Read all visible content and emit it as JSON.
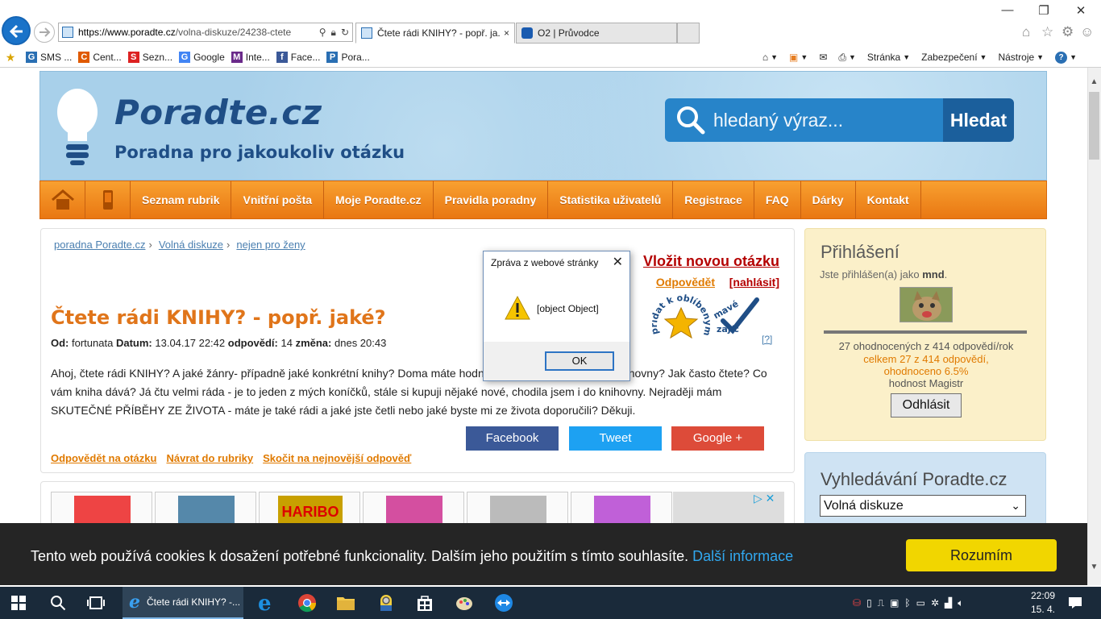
{
  "browser": {
    "url_domain": "https://www.poradte.cz",
    "url_path": "/volna-diskuze/24238-ctete",
    "tabs": [
      {
        "label": "Čtete rádi KNIHY? - popř. ja...",
        "close": "×"
      },
      {
        "label": "O2 | Průvodce"
      }
    ],
    "favorites": [
      {
        "label": "SMS ...",
        "icon": "G",
        "color": "#2a6fb3"
      },
      {
        "label": "Cent...",
        "icon": "C",
        "color": "#e05a00"
      },
      {
        "label": "Sezn...",
        "icon": "S",
        "color": "#d22"
      },
      {
        "label": "Google",
        "icon": "G",
        "color": "#4285f4"
      },
      {
        "label": "Inte...",
        "icon": "M",
        "color": "#6a2a8a"
      },
      {
        "label": "Face...",
        "icon": "f",
        "color": "#3b5998"
      },
      {
        "label": "Pora...",
        "icon": "P",
        "color": "#2a6fb3"
      }
    ],
    "commands": [
      {
        "label": "Stránka"
      },
      {
        "label": "Zabezpečení"
      },
      {
        "label": "Nástroje"
      }
    ]
  },
  "site": {
    "logo_title": "Poradte.cz",
    "logo_subtitle": "Poradna pro jakoukoliv otázku",
    "search_placeholder": "hledaný výraz...",
    "search_button": "Hledat",
    "nav": [
      "Seznam rubrik",
      "Vnitřní pošta",
      "Moje Poradte.cz",
      "Pravidla poradny",
      "Statistika uživatelů",
      "Registrace",
      "FAQ",
      "Dárky",
      "Kontakt"
    ]
  },
  "question": {
    "breadcrumb": [
      "poradna Poradte.cz",
      "Volná diskuze",
      "nejen pro ženy"
    ],
    "new_question": "Vložit novou otázku",
    "answer": "Odpovědět",
    "report": "[nahlásit]",
    "title": "Čtete rádi KNIHY? - popř. jaké?",
    "meta": {
      "from_label": "Od:",
      "from": "fortunata",
      "date_label": "Datum:",
      "date": "13.04.17 22:42",
      "answers_label": "odpovědí:",
      "answers": "14",
      "change_label": "změna:",
      "change": "dnes 20:43"
    },
    "body": "Ahoj, čtete rádi KNIHY? A jaké žánry- případně jaké konkrétní knihy? Doma máte hodně knih nebo si půjčujete z knihovny? Jak často čtete? Co vám kniha dává? Já čtu velmi ráda - je to jeden z mých koníčků, stále si kupuji nějaké nové, chodila jsem i do knihovny. Nejraději mám SKUTEČNÉ PŘÍBĚHY ZE ŽIVOTA - máte je také rádi a jaké jste četli nebo jaké byste mi ze života doporučili? Děkuji.",
    "help": "[?]",
    "share": {
      "facebook": "Facebook",
      "twitter": "Tweet",
      "google": "Google +"
    },
    "actions": [
      "Odpovědět na otázku",
      "Návrat do rubriky",
      "Skočit na nejnovější odpověď"
    ]
  },
  "login": {
    "title": "Přihlášení",
    "who_prefix": "Jste přihlášen(a) jako",
    "user": "mnd",
    "who_suffix": ".",
    "stats_line1": "27 ohodnocených z 414 odpovědí/rok",
    "stats_line2": "celkem 27 z 414 odpovědí,",
    "stats_line3": "ohodnoceno 6.5%",
    "stats_line4": "hodnost Magistr",
    "logout": "Odhlásit"
  },
  "side_search": {
    "title": "Vyhledávání Poradte.cz",
    "selected": "Volná diskuze"
  },
  "ads": {
    "brand": "HARIBO",
    "colors": [
      "#e44",
      "#58a",
      "#c8a000",
      "#d44fa0",
      "#bbb",
      "#c060d8"
    ]
  },
  "cookie": {
    "text": "Tento web používá cookies k dosažení potřebné funkcionality. Dalším jeho použitím s tímto souhlasíte.",
    "link": "Další informace",
    "button": "Rozumím"
  },
  "dialog": {
    "title": "Zpráva z webové stránky",
    "message": "[object Object]",
    "ok": "OK"
  },
  "taskbar": {
    "ie_label": "Čtete rádi KNIHY? -...",
    "time": "22:09",
    "date": "15. 4. 2017"
  },
  "colors": {
    "nav_orange": "#f08a20",
    "title_orange": "#e0751a",
    "header_blue": "#a8d0ea",
    "cookie_yellow": "#f1d600"
  }
}
